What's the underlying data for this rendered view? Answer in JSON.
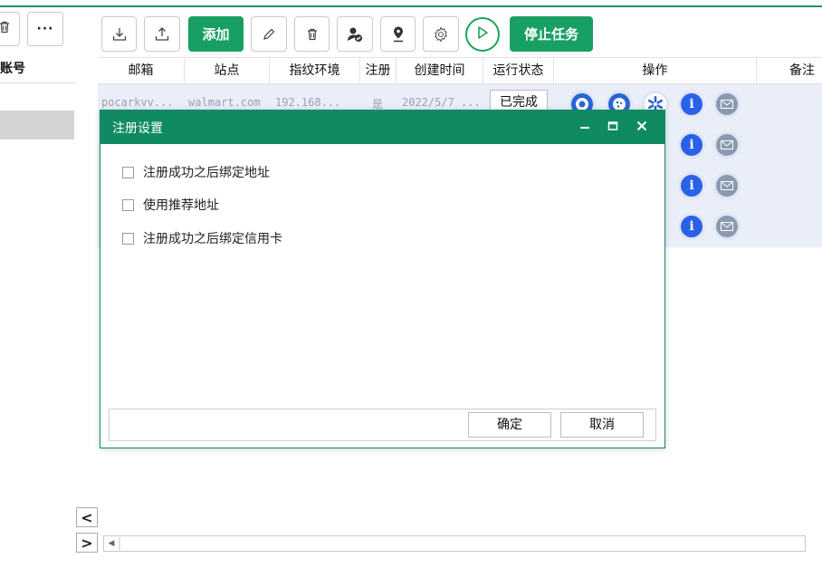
{
  "left_panel": {
    "header": "账号",
    "nav_prev": "<",
    "nav_next": ">"
  },
  "toolbar": {
    "add_label": "添加",
    "stop_label": "停止任务",
    "icons": [
      "download-icon",
      "upload-icon",
      "edit-icon",
      "trash-icon",
      "user-check-icon",
      "location-pin-icon",
      "gear-icon",
      "play-icon"
    ]
  },
  "table": {
    "columns": [
      "邮箱",
      "站点",
      "指纹环境",
      "注册",
      "创建时间",
      "运行状态",
      "操作",
      "备注"
    ],
    "rows": [
      {
        "email": "pocarkvv...",
        "site": "walmart.com",
        "fingerprint": "192.168...",
        "registered": "是",
        "created": "2022/5/7 ...",
        "status": "已完成"
      },
      {
        "status": ""
      },
      {
        "status": ""
      },
      {
        "status": ""
      }
    ]
  },
  "dialog": {
    "title": "注册设置",
    "options": [
      {
        "label": "注册成功之后绑定地址",
        "checked": false
      },
      {
        "label": "使用推荐地址",
        "checked": false
      },
      {
        "label": "注册成功之后绑定信用卡",
        "checked": false
      }
    ],
    "ok_label": "确定",
    "cancel_label": "取消"
  },
  "colors": {
    "brand_green": "#0f8a62",
    "button_green": "#18a064",
    "row_bg": "#eaeef9",
    "info_blue": "#2962e8"
  }
}
